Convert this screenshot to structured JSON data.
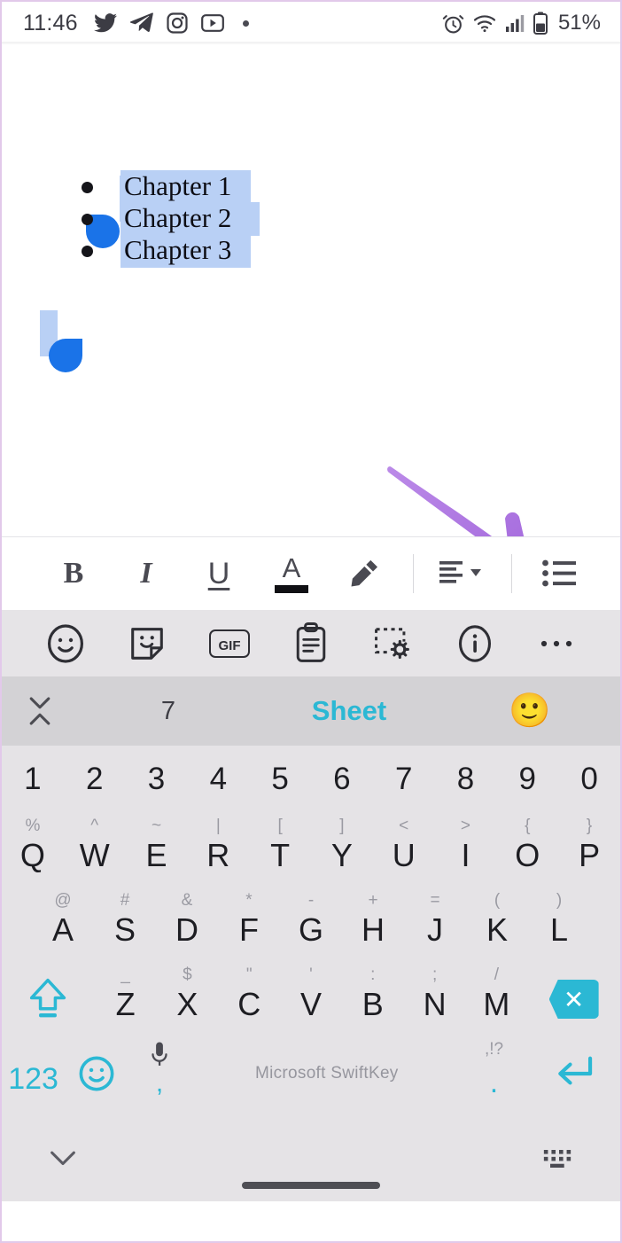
{
  "status_bar": {
    "time": "11:46",
    "left_icons": [
      "twitter-icon",
      "telegram-icon",
      "instagram-icon",
      "youtube-icon",
      "notification-dot-icon"
    ],
    "right_icons": [
      "alarm-icon",
      "wifi-icon",
      "signal-icon",
      "battery-icon"
    ],
    "battery_level": "51%"
  },
  "document": {
    "lines": [
      {
        "bullet": "•",
        "text": "Chapter 1"
      },
      {
        "bullet": "•",
        "text": "Chapter 2"
      },
      {
        "bullet": "•",
        "text": "Chapter 3"
      }
    ],
    "selection_highlight_color": "#b9d0f5",
    "selection_handle_color": "#1a73e8"
  },
  "annotation": {
    "type": "arrow",
    "color": "#b077e0",
    "points_to": "bullet-list-button"
  },
  "format_toolbar": {
    "items": [
      {
        "name": "bold-button",
        "label": "B"
      },
      {
        "name": "italic-button",
        "label": "I"
      },
      {
        "name": "underline-button",
        "label": "U"
      },
      {
        "name": "text-color-button",
        "label": "A",
        "swatch_color": "#101014"
      },
      {
        "name": "highlight-button",
        "label": ""
      },
      {
        "name": "align-button",
        "label": ""
      },
      {
        "name": "bullet-list-button",
        "label": ""
      }
    ]
  },
  "keyboard_toolbar": {
    "items": [
      {
        "name": "emoji-icon",
        "label": "emoji"
      },
      {
        "name": "sticker-icon",
        "label": "sticker"
      },
      {
        "name": "gif-icon",
        "label": "GIF"
      },
      {
        "name": "clipboard-icon",
        "label": "clipboard"
      },
      {
        "name": "stickers-settings-icon",
        "label": "settings"
      },
      {
        "name": "info-icon",
        "label": "info"
      },
      {
        "name": "more-icon",
        "label": "more"
      }
    ]
  },
  "prediction_bar": {
    "collapse_icon": "collapse-toolbar-icon",
    "candidates": [
      "7",
      "Sheet",
      "🙂"
    ],
    "highlight_color": "#2bb8d4"
  },
  "keyboard": {
    "rows": [
      {
        "name": "number-row",
        "keys": [
          {
            "main": "1"
          },
          {
            "main": "2"
          },
          {
            "main": "3"
          },
          {
            "main": "4"
          },
          {
            "main": "5"
          },
          {
            "main": "6"
          },
          {
            "main": "7"
          },
          {
            "main": "8"
          },
          {
            "main": "9"
          },
          {
            "main": "0"
          }
        ]
      },
      {
        "name": "qwerty-row",
        "keys": [
          {
            "main": "Q",
            "sec": "%"
          },
          {
            "main": "W",
            "sec": "^"
          },
          {
            "main": "E",
            "sec": "~"
          },
          {
            "main": "R",
            "sec": "|"
          },
          {
            "main": "T",
            "sec": "["
          },
          {
            "main": "Y",
            "sec": "]"
          },
          {
            "main": "U",
            "sec": "<"
          },
          {
            "main": "I",
            "sec": ">"
          },
          {
            "main": "O",
            "sec": "{"
          },
          {
            "main": "P",
            "sec": "}"
          }
        ]
      },
      {
        "name": "home-row",
        "keys": [
          {
            "main": "A",
            "sec": "@"
          },
          {
            "main": "S",
            "sec": "#"
          },
          {
            "main": "D",
            "sec": "&"
          },
          {
            "main": "F",
            "sec": "*"
          },
          {
            "main": "G",
            "sec": "-"
          },
          {
            "main": "H",
            "sec": "+"
          },
          {
            "main": "J",
            "sec": "="
          },
          {
            "main": "K",
            "sec": "("
          },
          {
            "main": "L",
            "sec": ")"
          }
        ]
      },
      {
        "name": "bottom-letter-row",
        "keys": [
          {
            "main": "Z",
            "sec": "_"
          },
          {
            "main": "X",
            "sec": "$"
          },
          {
            "main": "C",
            "sec": "\""
          },
          {
            "main": "V",
            "sec": "'"
          },
          {
            "main": "B",
            "sec": ":"
          },
          {
            "main": "N",
            "sec": ";"
          },
          {
            "main": "M",
            "sec": "/"
          }
        ]
      }
    ],
    "shift_key": "shift-key",
    "backspace_key": "backspace-key",
    "numeric_key": "123",
    "emoji_key": "emoji-key",
    "comma_key": ",",
    "mic_icon": "microphone-icon",
    "space_label": "Microsoft SwiftKey",
    "period_key": ".",
    "period_sec": ",!?",
    "enter_key": "enter-key",
    "accent_color": "#2bb8d4"
  },
  "nav_bar": {
    "hide_keyboard_icon": "chevron-down-icon",
    "keyboard_switch_icon": "keyboard-switch-icon",
    "gesture_pill": "home-gesture-pill"
  }
}
